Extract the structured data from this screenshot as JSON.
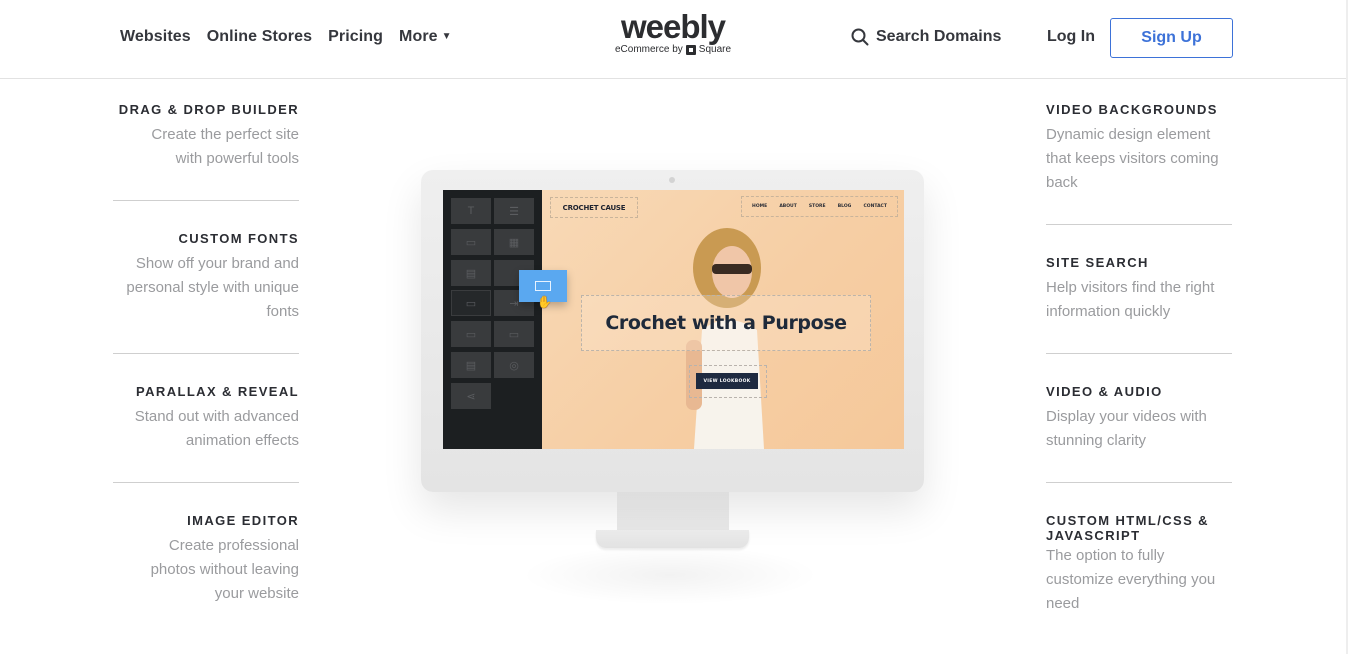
{
  "header": {
    "nav": [
      {
        "label": "Websites"
      },
      {
        "label": "Online Stores"
      },
      {
        "label": "Pricing"
      },
      {
        "label": "More",
        "icon": "caret-down-icon"
      }
    ],
    "logo": {
      "main": "weebly",
      "sub_prefix": "eCommerce by",
      "sub_brand": "Square"
    },
    "search_domains": "Search Domains",
    "login": "Log In",
    "signup": "Sign Up",
    "accent_color": "#3d72d8"
  },
  "features_left": [
    {
      "title": "DRAG & DROP BUILDER",
      "desc": [
        "Create the perfect site",
        "with powerful tools"
      ]
    },
    {
      "title": "CUSTOM FONTS",
      "desc": [
        "Show off your brand and",
        "personal style with unique",
        "fonts"
      ]
    },
    {
      "title": "PARALLAX & REVEAL",
      "desc": [
        "Stand out with advanced",
        "animation effects"
      ]
    },
    {
      "title": "IMAGE EDITOR",
      "desc": [
        "Create professional",
        "photos without leaving",
        "your website"
      ]
    }
  ],
  "features_right": [
    {
      "title": "VIDEO BACKGROUNDS",
      "desc": [
        "Dynamic design element",
        "that keeps visitors coming",
        "back"
      ]
    },
    {
      "title": "SITE SEARCH",
      "desc": [
        "Help visitors find the right",
        "information quickly"
      ]
    },
    {
      "title": "VIDEO & AUDIO",
      "desc": [
        "Display your videos with",
        "stunning clarity"
      ]
    },
    {
      "title": "CUSTOM HTML/CSS &",
      "title2": "JAVASCRIPT",
      "desc": [
        "The option to fully",
        "customize everything you",
        "need"
      ]
    }
  ],
  "monitor": {
    "site_logo": "CROCHET CAUSE",
    "site_nav": [
      "HOME",
      "ABOUT",
      "STORE",
      "BLOG",
      "CONTACT"
    ],
    "hero_title": "Crochet with a Purpose",
    "cta": "VIEW LOOKBOOK",
    "builder_tiles": [
      "text-icon",
      "divider-icon",
      "image-icon",
      "gallery-icon",
      "image-text-icon",
      "button-icon",
      "slideshow-icon",
      "spacer-icon",
      "video-icon",
      "video-embed-icon",
      "document-icon",
      "map-icon",
      "share-icon"
    ]
  }
}
